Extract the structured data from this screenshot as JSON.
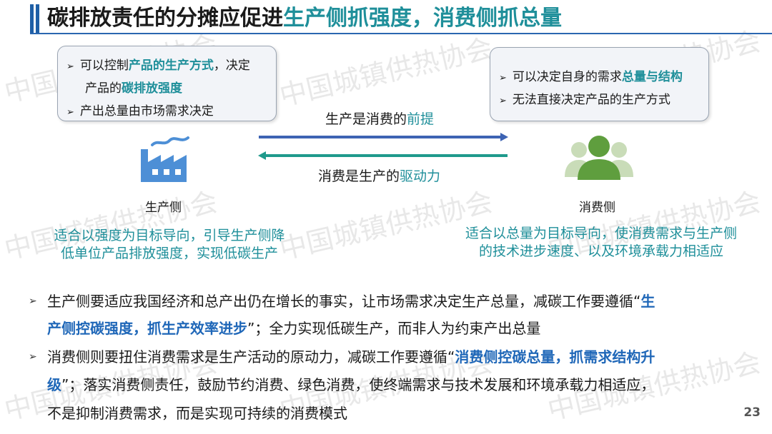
{
  "title": {
    "part1": "碳排放责任的分摊应促进",
    "part2": "生产侧抓强度，消费侧抓总量"
  },
  "watermark": "中国城镇供热协会",
  "producer_box": {
    "line1_a": "可以控制",
    "line1_b": "产品的生产方式",
    "line1_c": "，决定",
    "line2_a": "产品的",
    "line2_b": "碳排放强度",
    "line3": "产出总量由市场需求决定"
  },
  "consumer_box": {
    "line1_a": "可以决定自身的需求",
    "line1_b": "总量与结构",
    "line2": "无法直接决定产品的生产方式"
  },
  "flow": {
    "top_a": "生产是消费的",
    "top_b": "前提",
    "bottom_a": "消费是生产的",
    "bottom_b": "驱动力"
  },
  "producer_label": "生产侧",
  "consumer_label": "消费侧",
  "producer_summary": [
    "适合以强度为目标导向，引导生产侧降",
    "低单位产品排放强度，实现低碳生产"
  ],
  "consumer_summary": [
    "适合以总量为目标导向，使消费需求与生产侧",
    "的技术进步速度、以及环境承载力相适应"
  ],
  "bullets": {
    "b1_l1_a": "生产侧要适应我国经济和总产出仍在增长的事实，让市场需求决定生产总量，减碳工作要遵循“",
    "b1_l1_b": "生",
    "b1_l2_a": "产侧控碳强度，抓生产效率进步",
    "b1_l2_b": "”；全力实现低碳生产，而非人为约束产出总量",
    "b2_l1_a": "消费侧则要扭住消费需求是生产活动的原动力，减碳工作要遵循“",
    "b2_l1_b": "消费侧控碳总量，抓需求结构升",
    "b2_l2_a": "级",
    "b2_l2_b": "”；落实消费侧责任，鼓励节约消费、绿色消费，使终端需求与技术发展和环境承载力相适应，",
    "b2_l3": "不是抑制消费需求，而是实现可持续的消费模式"
  },
  "page_number": "23",
  "colors": {
    "title_bar": "#1f5fa6",
    "accent_teal": "#1f8f9a",
    "accent_blue": "#1f67b8",
    "factory": "#4d8fd6",
    "person": "#5f9e3e"
  }
}
